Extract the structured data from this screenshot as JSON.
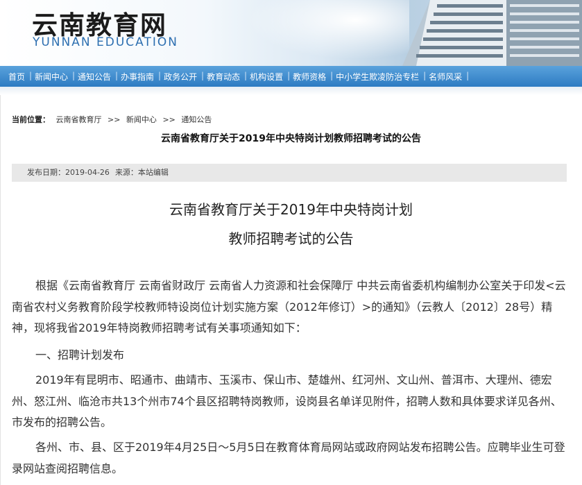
{
  "header": {
    "site_name": "云南教育网",
    "site_name_en": "YUNNAN EDUCATION"
  },
  "nav": {
    "items": [
      "首页",
      "新闻中心",
      "通知公告",
      "办事指南",
      "政务公开",
      "教育动态",
      "机构设置",
      "教师资格",
      "中小学生欺凌防治专栏",
      "名师风采"
    ]
  },
  "breadcrumb": {
    "label": "当前位置：",
    "items": [
      "云南省教育厅",
      ">>",
      "新闻中心",
      ">>",
      "通知公告"
    ]
  },
  "page_title": "云南省教育厅关于2019年中央特岗计划教师招聘考试的公告",
  "meta": {
    "date": "发布日期：2019-04-26",
    "source": "来源：本站编辑"
  },
  "article": {
    "title_line1": "云南省教育厅关于2019年中央特岗计划",
    "title_line2": "教师招聘考试的公告",
    "para1": "根据《云南省教育厅 云南省财政厅 云南省人力资源和社会保障厅 中共云南省委机构编制办公室关于印发<云南省农村义务教育阶段学校教师特设岗位计划实施方案（2012年修订）>的通知》（云教人〔2012〕28号）精神，现将我省2019年特岗教师招聘考试有关事项通知如下：",
    "section1": "一、招聘计划发布",
    "para2": "2019年有昆明市、昭通市、曲靖市、玉溪市、保山市、楚雄州、红河州、文山州、普洱市、大理州、德宏州、怒江州、临沧市共13个州市74个县区招聘特岗教师，设岗县名单详见附件，招聘人数和具体要求详见各州、市发布的招聘公告。",
    "para3": "各州、市、县、区于2019年4月25日～5月5日在教育体育局网站或政府网站发布招聘公告。应聘毕业生可登录网站查阅招聘信息。"
  }
}
